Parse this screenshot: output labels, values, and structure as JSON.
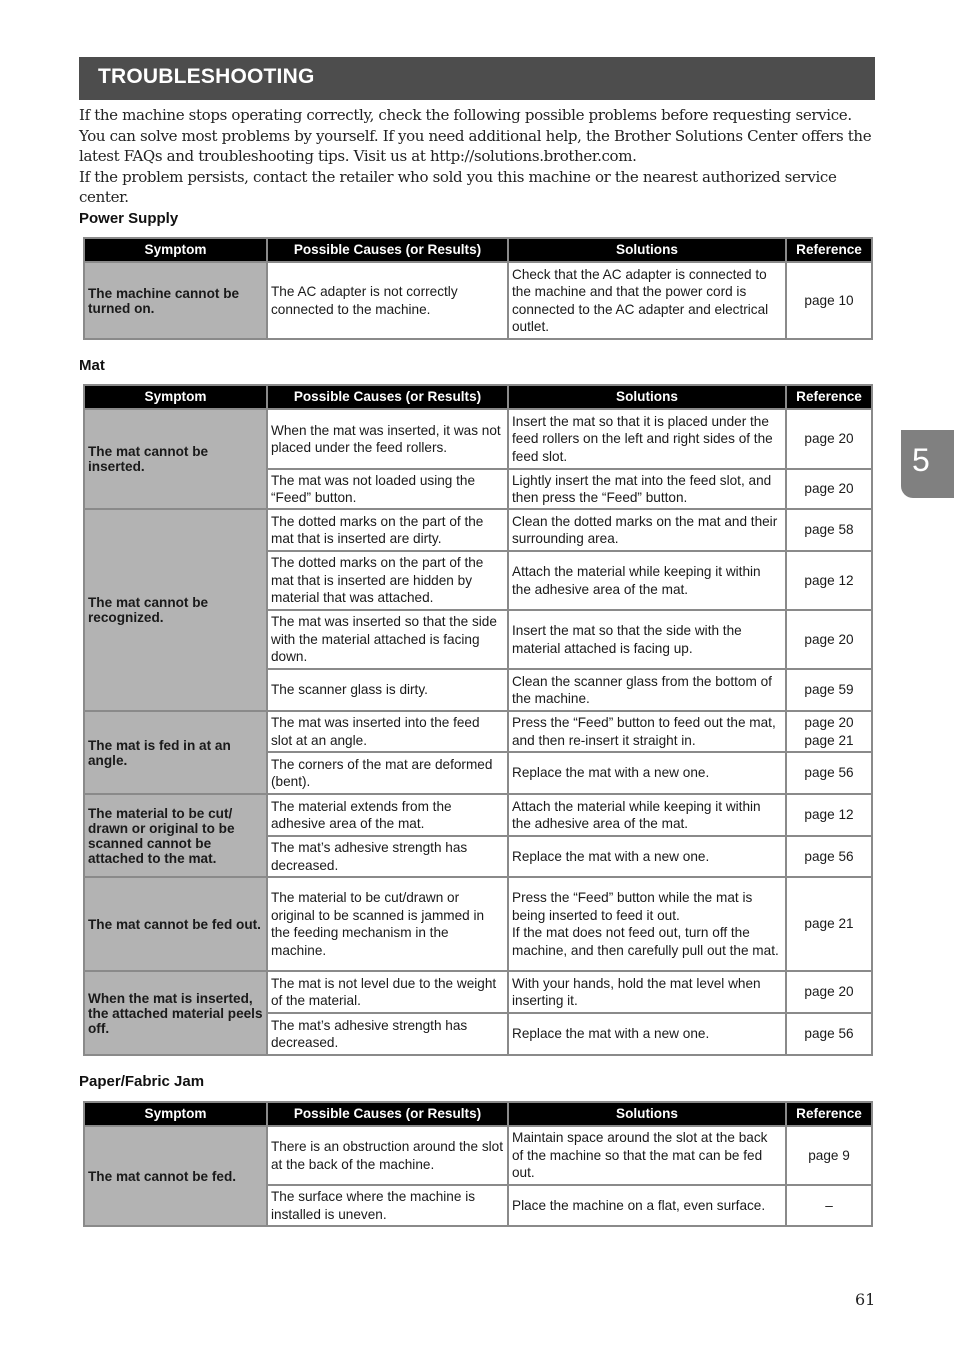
{
  "title": "TROUBLESHOOTING",
  "intro": [
    "If the machine stops operating correctly, check the following possible problems before requesting service.",
    "You can solve most problems by yourself. If you need additional help, the Brother Solutions Center offers the latest FAQs and troubleshooting tips. Visit us at http://solutions.brother.com.",
    "If the problem persists, contact the retailer who sold you this machine or the nearest authorized service center."
  ],
  "headers": {
    "symptom": "Symptom",
    "causes": "Possible Causes (or Results)",
    "solutions": "Solutions",
    "reference": "Reference"
  },
  "sections": {
    "power": {
      "title": "Power Supply",
      "groups": [
        {
          "symptom": "The machine cannot be turned on.",
          "rows": [
            {
              "cause": "The AC adapter is not correctly connected to the machine.",
              "solution": "Check that the AC adapter is connected to the machine and that the power cord is connected to the AC adapter and electrical outlet.",
              "reference": "page 10"
            }
          ]
        }
      ]
    },
    "mat": {
      "title": "Mat",
      "groups": [
        {
          "symptom": "The mat cannot be inserted.",
          "rows": [
            {
              "cause": "When the mat was inserted, it was not placed under the feed rollers.",
              "solution": "Insert the mat so that it is placed under the feed rollers on the left and right sides of the feed slot.",
              "reference": "page 20"
            },
            {
              "cause": "The mat was not loaded using the “Feed” button.",
              "solution": "Lightly insert the mat into the feed slot, and then press the “Feed” button.",
              "reference": "page 20"
            }
          ]
        },
        {
          "symptom": "The mat cannot be recognized.",
          "rows": [
            {
              "cause": "The dotted marks on the part of the mat that is inserted are dirty.",
              "solution": "Clean the dotted marks on the mat and their surrounding area.",
              "reference": "page 58"
            },
            {
              "cause": "The dotted marks on the part of the mat that is inserted are hidden by material that was attached.",
              "solution": "Attach the material while keeping it within the adhesive area of the mat.",
              "reference": "page 12"
            },
            {
              "cause": "The mat was inserted so that the side with the material attached is facing down.",
              "solution": "Insert the mat so that the side with the material attached is facing up.",
              "reference": "page 20"
            },
            {
              "cause": "The scanner glass is dirty.",
              "solution": "Clean the scanner glass from the bottom of the machine.",
              "reference": "page 59"
            }
          ]
        },
        {
          "symptom": "The mat is fed in at an angle.",
          "rows": [
            {
              "cause": "The mat was inserted into the feed slot at an angle.",
              "solution": "Press the “Feed” button to feed out the mat, and then re-insert it straight in.",
              "reference": "page 20\npage 21"
            },
            {
              "cause": "The corners of the mat are deformed (bent).",
              "solution": "Replace the mat with a new one.",
              "reference": "page 56"
            }
          ]
        },
        {
          "symptom": "The material to be cut/ drawn or original to be scanned cannot be attached to the mat.",
          "rows": [
            {
              "cause": "The material extends from the adhesive area of the mat.",
              "solution": "Attach the material while keeping it within the adhesive area of the mat.",
              "reference": "page 12"
            },
            {
              "cause": "The mat’s adhesive strength has decreased.",
              "solution": "Replace the mat with a new one.",
              "reference": "page 56"
            }
          ]
        },
        {
          "symptom": "The mat cannot be fed out.",
          "rows": [
            {
              "cause": "The material to be cut/drawn or original to be scanned is jammed in the feeding mechanism in the machine.",
              "solution": "Press the “Feed” button while the mat is being inserted to feed it out.\nIf the mat does not feed out, turn off the machine, and then carefully pull out the mat.",
              "reference": "page 21"
            }
          ]
        },
        {
          "symptom": "When the mat is inserted, the attached material peels off.",
          "rows": [
            {
              "cause": "The mat is not level due to the weight of the material.",
              "solution": "With your hands, hold the mat level when inserting it.",
              "reference": "page 20"
            },
            {
              "cause": "The mat’s adhesive strength has decreased.",
              "solution": "Replace the mat with a new one.",
              "reference": "page 56"
            }
          ]
        }
      ]
    },
    "jam": {
      "title": "Paper/Fabric Jam",
      "groups": [
        {
          "symptom": "The mat cannot be fed.",
          "rows": [
            {
              "cause": "There is an obstruction around the slot at the back of the machine.",
              "solution": "Maintain space around the slot at the back of the machine so that the mat can be fed out.",
              "reference": "page 9"
            },
            {
              "cause": "The surface where the machine is installed is uneven.",
              "solution": "Place the machine on a flat, even surface.",
              "reference": "–"
            }
          ]
        }
      ]
    }
  },
  "chapter_tab": "5",
  "page_number": "61"
}
